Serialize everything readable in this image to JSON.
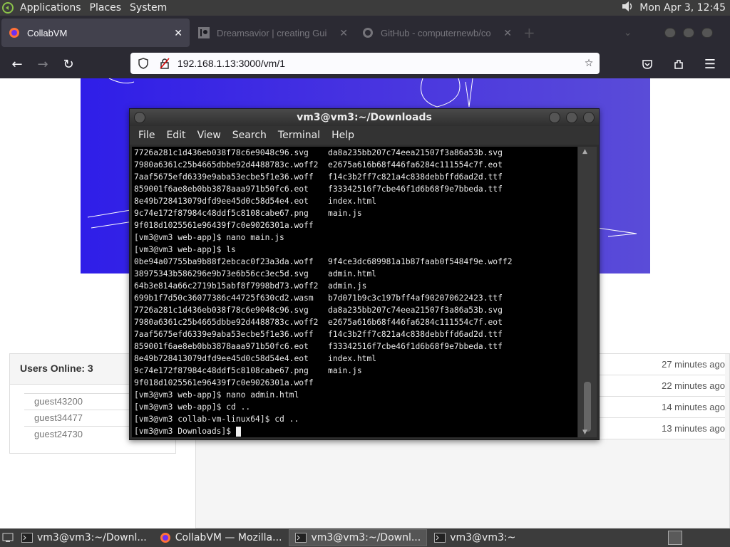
{
  "top_panel": {
    "menus": [
      "Applications",
      "Places",
      "System"
    ],
    "datetime": "Mon Apr  3, 12:45"
  },
  "browser": {
    "tabs": [
      {
        "title": "CollabVM",
        "active": true
      },
      {
        "title": "Dreamsavior | creating Gui",
        "active": false
      },
      {
        "title": "GitHub - computernewb/co",
        "active": false
      }
    ],
    "url": "192.168.1.13:3000/vm/1"
  },
  "page": {
    "users_header": "Users Online: 3",
    "users": [
      "guest43200",
      "guest34477",
      "guest24730"
    ],
    "chat_times": [
      "27 minutes ago",
      "22 minutes ago",
      "14 minutes ago",
      "13 minutes ago"
    ]
  },
  "terminal": {
    "title": "vm3@vm3:~/Downloads",
    "menu": [
      "File",
      "Edit",
      "View",
      "Search",
      "Terminal",
      "Help"
    ],
    "lines": [
      "7726a281c1d436eb038f78c6e9048c96.svg    da8a235bb207c74eea21507f3a86a53b.svg",
      "7980a6361c25b4665dbbe92d4488783c.woff2  e2675a616b68f446fa6284c111554c7f.eot",
      "7aaf5675efd6339e9aba53ecbe5f1e36.woff   f14c3b2ff7c821a4c838debbffd6ad2d.ttf",
      "859001f6ae8eb0bb3878aaa971b50fc6.eot    f33342516f7cbe46f1d6b68f9e7bbeda.ttf",
      "8e49b728413079dfd9ee45d0c58d54e4.eot    index.html",
      "9c74e172f87984c48ddf5c8108cabe67.png    main.js",
      "9f018d1025561e96439f7c0e9026301a.woff",
      "[vm3@vm3 web-app]$ nano main.js",
      "[vm3@vm3 web-app]$ ls",
      "0be94a07755ba9b88f2ebcac0f23a3da.woff   9f4ce3dc689981a1b87faab0f5484f9e.woff2",
      "38975343b586296e9b73e6b56cc3ec5d.svg    admin.html",
      "64b3e814a66c2719b15abf8f7998bd73.woff2  admin.js",
      "699b1f7d50c36077386c44725f630cd2.wasm   b7d071b9c3c197bff4af902070622423.ttf",
      "7726a281c1d436eb038f78c6e9048c96.svg    da8a235bb207c74eea21507f3a86a53b.svg",
      "7980a6361c25b4665dbbe92d4488783c.woff2  e2675a616b68f446fa6284c111554c7f.eot",
      "7aaf5675efd6339e9aba53ecbe5f1e36.woff   f14c3b2ff7c821a4c838debbffd6ad2d.ttf",
      "859001f6ae8eb0bb3878aaa971b50fc6.eot    f33342516f7cbe46f1d6b68f9e7bbeda.ttf",
      "8e49b728413079dfd9ee45d0c58d54e4.eot    index.html",
      "9c74e172f87984c48ddf5c8108cabe67.png    main.js",
      "9f018d1025561e96439f7c0e9026301a.woff",
      "[vm3@vm3 web-app]$ nano admin.html",
      "[vm3@vm3 web-app]$ cd ..",
      "[vm3@vm3 collab-vm-linux64]$ cd ..",
      "[vm3@vm3 Downloads]$ "
    ]
  },
  "taskbar": {
    "items": [
      {
        "label": "vm3@vm3:~/Downl...",
        "icon": "terminal-icon",
        "active": false
      },
      {
        "label": "CollabVM — Mozilla...",
        "icon": "firefox-icon",
        "active": false
      },
      {
        "label": "vm3@vm3:~/Downl...",
        "icon": "terminal-icon",
        "active": true
      },
      {
        "label": "vm3@vm3:~",
        "icon": "terminal-icon",
        "active": false
      }
    ]
  },
  "colors": {
    "vm_screen_bg": "#3a28e4",
    "terminal_bg": "#000000",
    "panel_bg": "#3c3c3c"
  }
}
